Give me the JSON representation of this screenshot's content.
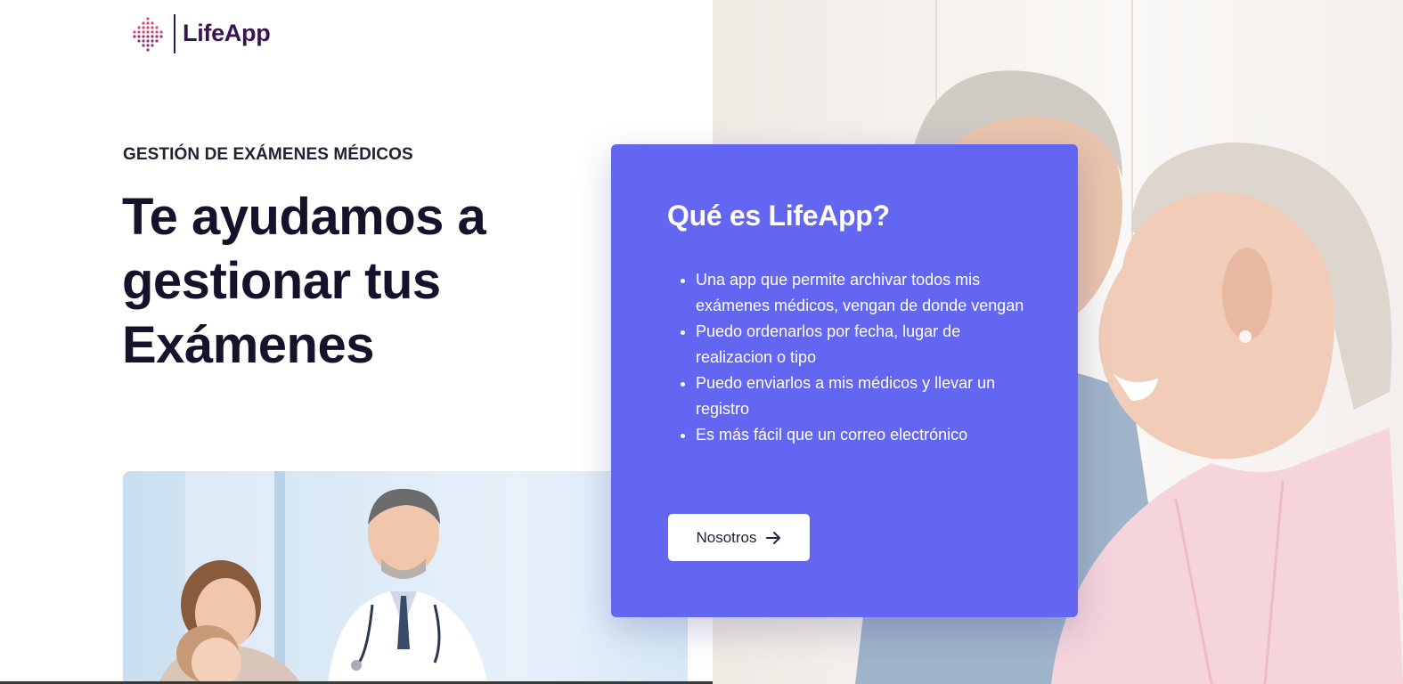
{
  "brand": {
    "name": "LifeApp",
    "logo_icon": "dotted-heart-icon",
    "colors": {
      "brand": "#3a1450",
      "logo_dots_top": "#e1456e",
      "logo_dots_bottom": "#7b2c8f"
    }
  },
  "hero": {
    "eyebrow": "GESTIÓN DE EXÁMENES MÉDICOS",
    "headline": "Te ayudamos a gestionar tus Exámenes"
  },
  "card": {
    "title": "Qué es LifeApp?",
    "background": "#6366f1",
    "items": [
      "Una app que permite archivar todos mis exámenes médicos, vengan de donde vengan",
      "Puedo ordenarlos por fecha, lugar de realizacion o tipo",
      "Puedo enviarlos a mis médicos y llevar un registro",
      "Es más fácil que un correo electrónico"
    ],
    "button": {
      "label": "Nosotros",
      "icon": "arrow-right-icon"
    }
  },
  "images": {
    "hero_photo": "smiling-senior-couple-photo",
    "doctor_photo": "doctor-with-mother-and-child-photo"
  }
}
